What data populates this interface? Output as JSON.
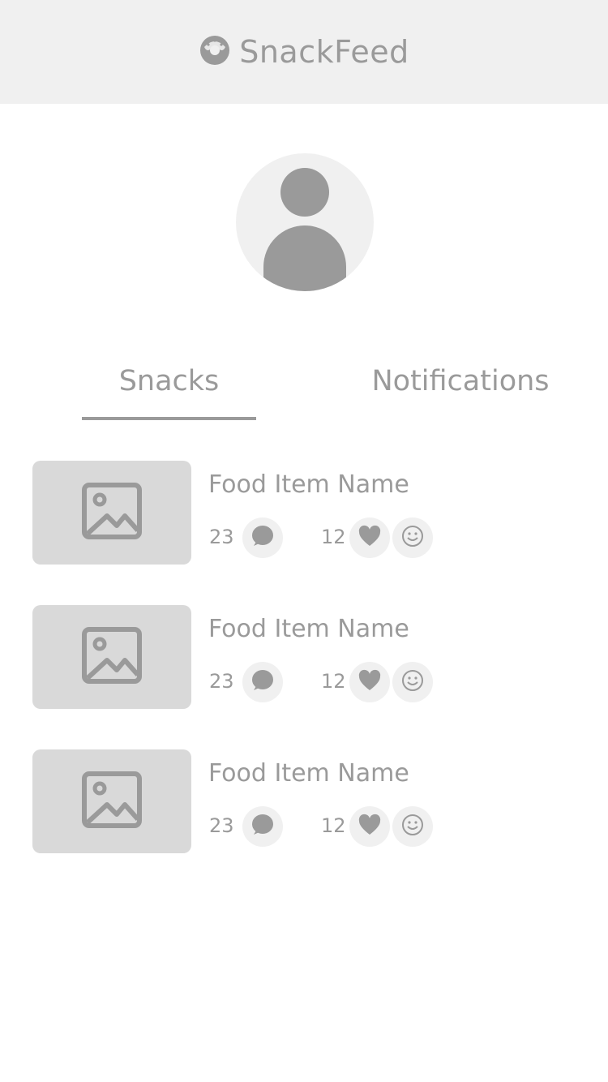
{
  "header": {
    "app_title": "SnackFeed",
    "logo_icon": "donut-icon",
    "background": "#f0f0f0"
  },
  "profile": {
    "avatar_icon": "user-avatar-icon"
  },
  "tabs": [
    {
      "label": "Snacks",
      "active": true
    },
    {
      "label": "Notifications",
      "active": false
    }
  ],
  "feed": {
    "items": [
      {
        "name": "Food Item Name",
        "comments": "23",
        "likes": "12"
      },
      {
        "name": "Food Item Name",
        "comments": "23",
        "likes": "12"
      },
      {
        "name": "Food Item Name",
        "comments": "23",
        "likes": "12"
      }
    ]
  },
  "icons": {
    "thumbnail": "image-placeholder-icon",
    "comment": "comment-bubble-icon",
    "like": "heart-icon",
    "reaction": "smiley-icon"
  },
  "colors": {
    "gray": "#9a9a9a",
    "light_gray": "#f0f0f0",
    "thumb_gray": "#d9d9d9"
  }
}
